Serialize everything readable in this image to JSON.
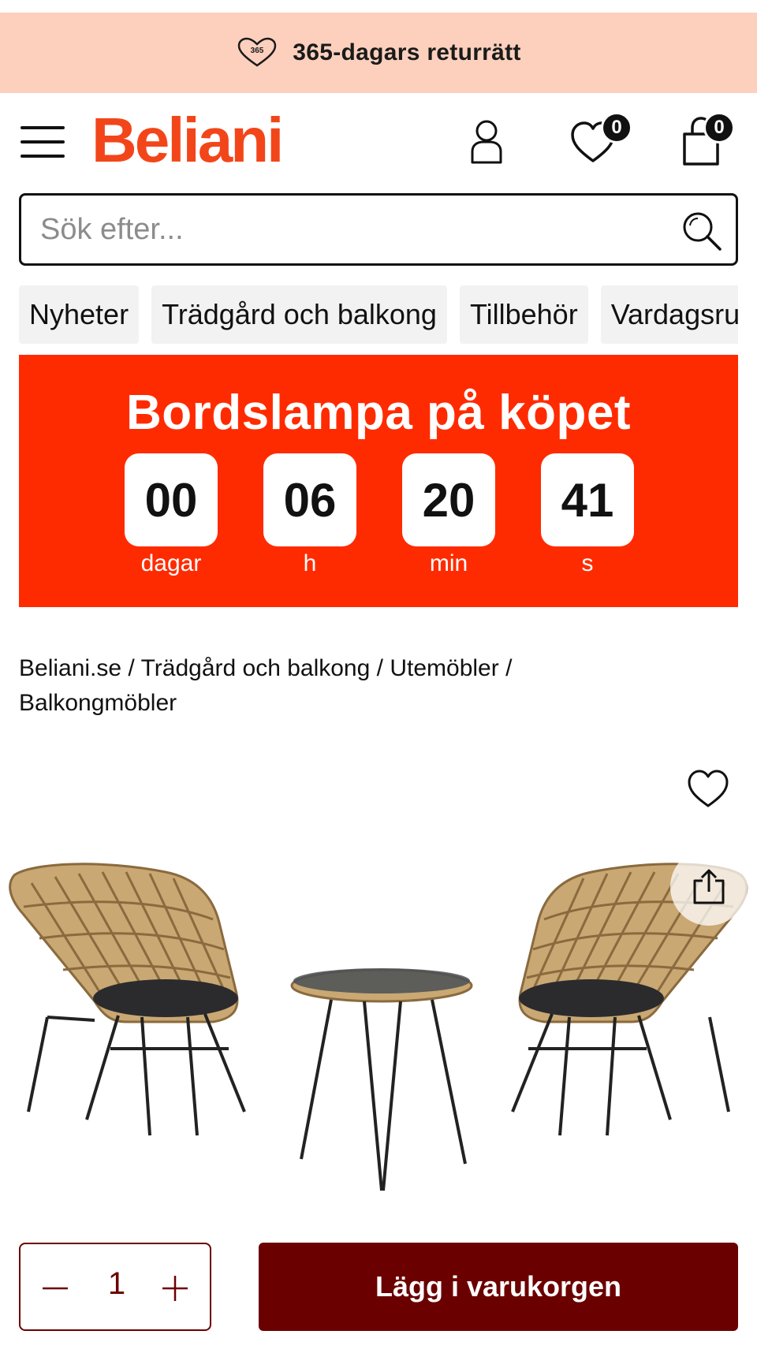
{
  "promo": {
    "text": "365-dagars returrätt",
    "icon": "heart-365-icon",
    "icon_text": "365"
  },
  "header": {
    "logo": "Beliani",
    "wishlist_count": "0",
    "cart_count": "0"
  },
  "search": {
    "placeholder": "Sök efter..."
  },
  "categories": [
    "Nyheter",
    "Trädgård och balkong",
    "Tillbehör",
    "Vardagsrum"
  ],
  "banner": {
    "title": "Bordslampa på köpet",
    "countdown": [
      {
        "value": "00",
        "unit": "dagar"
      },
      {
        "value": "06",
        "unit": "h"
      },
      {
        "value": "20",
        "unit": "min"
      },
      {
        "value": "41",
        "unit": "s"
      }
    ]
  },
  "breadcrumb": {
    "items": [
      "Beliani.se",
      "Trädgård och balkong",
      "Utemöbler",
      "Balkongmöbler"
    ],
    "separator": "/"
  },
  "purchase": {
    "quantity": "1",
    "minus": "−",
    "plus": "+",
    "add_to_cart": "Lägg i varukorgen"
  },
  "colors": {
    "brand": "#f2461a",
    "promo_bg": "#fcd0bd",
    "banner_bg": "#ff2b00",
    "cart_button": "#6b0000"
  }
}
